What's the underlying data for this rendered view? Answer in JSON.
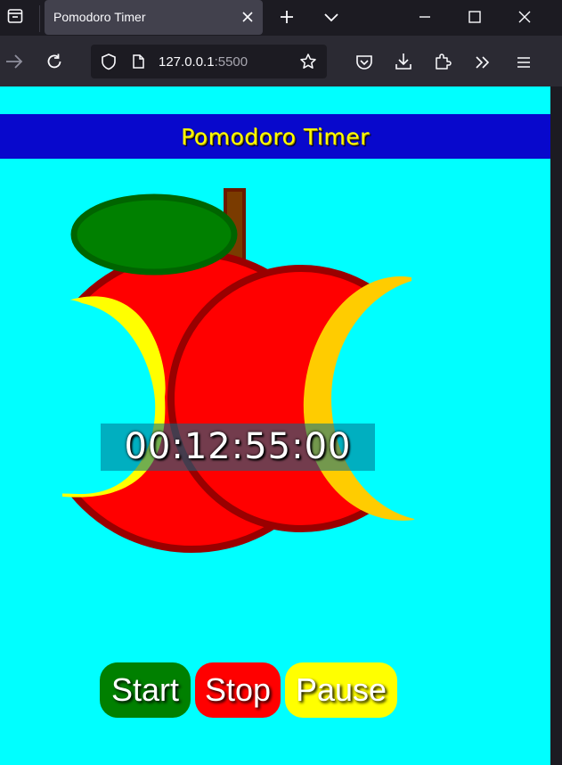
{
  "browser": {
    "tab_title": "Pomodoro Timer",
    "url_host": "127.0.0.1",
    "url_port": ":5500",
    "icons": [
      "tab-list-icon",
      "close-icon",
      "plus-icon",
      "chevron-down-icon",
      "minimize-icon",
      "maximize-icon",
      "close-window-icon",
      "forward-arrow-icon",
      "reload-icon",
      "shield-icon",
      "page-icon",
      "star-icon",
      "pocket-icon",
      "download-icon",
      "extensions-icon",
      "overflow-chevrons-icon",
      "hamburger-menu-icon"
    ]
  },
  "page": {
    "title": "Pomodoro Timer",
    "timer": "00:12:55:00",
    "buttons": {
      "start": "Start",
      "stop": "Stop",
      "pause": "Pause"
    }
  },
  "colors": {
    "background": "#00ffff",
    "header_bg": "#0808cc",
    "header_text": "#ffff00",
    "apple_red": "#ff0000",
    "apple_outline": "#990000",
    "leaf": "#008000",
    "stem": "#7a3b00",
    "core_yellow": "#ffff00",
    "core_orange": "#ffcc00",
    "start": "#008000",
    "stop": "#ff0000",
    "pause": "#ffff00"
  }
}
